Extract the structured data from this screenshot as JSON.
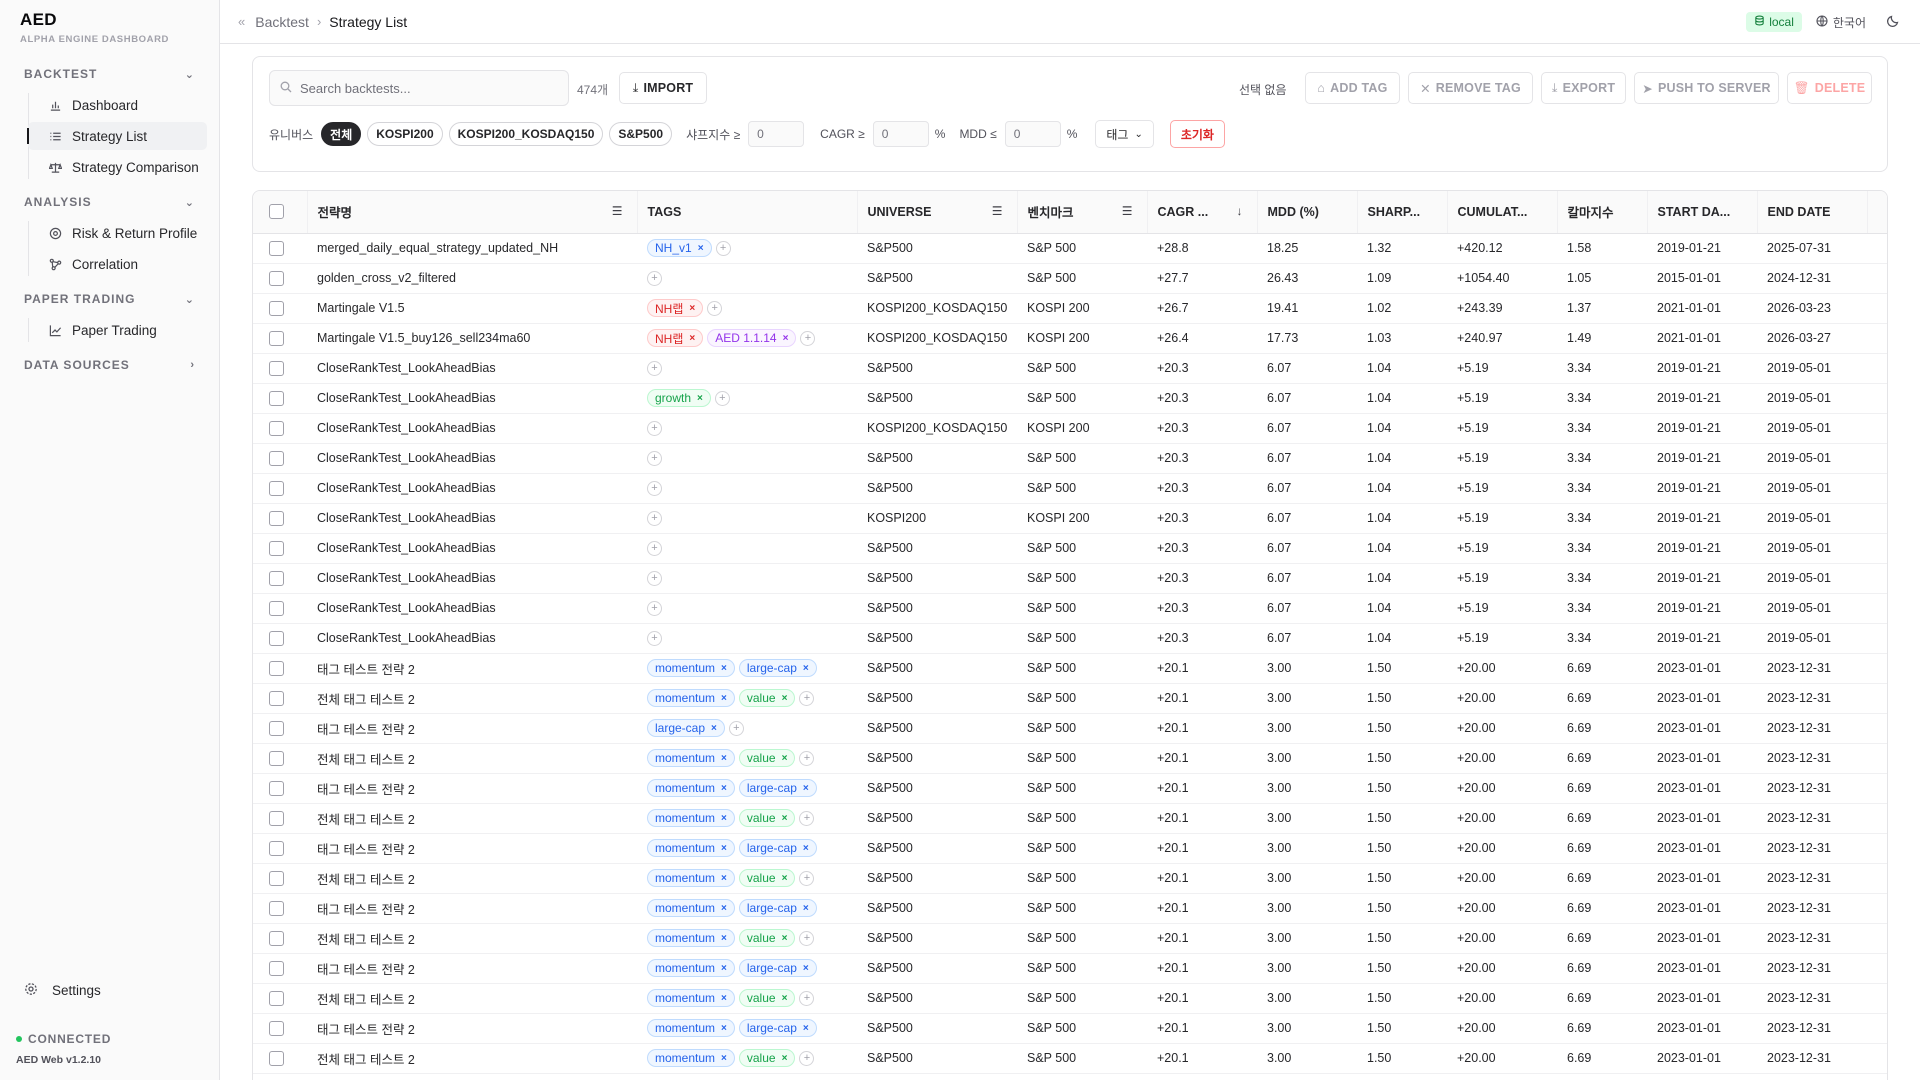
{
  "brand": {
    "name": "AED",
    "subtitle": "ALPHA ENGINE DASHBOARD"
  },
  "sidebar": {
    "sections": [
      {
        "label": "BACKTEST",
        "chevron": "chevron-down-icon",
        "items": [
          {
            "label": "Dashboard",
            "icon": "bar-chart-icon"
          },
          {
            "label": "Strategy List",
            "icon": "list-icon",
            "active": true
          },
          {
            "label": "Strategy Comparison",
            "icon": "scale-icon"
          }
        ]
      },
      {
        "label": "ANALYSIS",
        "chevron": "chevron-down-icon",
        "items": [
          {
            "label": "Risk & Return Profile",
            "icon": "target-icon"
          },
          {
            "label": "Correlation",
            "icon": "network-icon"
          }
        ]
      },
      {
        "label": "PAPER TRADING",
        "chevron": "chevron-down-icon",
        "items": [
          {
            "label": "Paper Trading",
            "icon": "line-chart-icon"
          }
        ]
      },
      {
        "label": "DATA SOURCES",
        "chevron": "chevron-right-icon",
        "items": []
      }
    ],
    "settings_label": "Settings",
    "status": "CONNECTED",
    "version": "AED Web v1.2.10"
  },
  "header": {
    "breadcrumb_parent": "Backtest",
    "breadcrumb_current": "Strategy List",
    "env_badge": "local",
    "language": "한국어"
  },
  "toolbar": {
    "search_placeholder": "Search backtests...",
    "count": "474개",
    "import_label": "IMPORT",
    "selection_text": "선택 없음",
    "add_tag_label": "ADD TAG",
    "remove_tag_label": "REMOVE TAG",
    "export_label": "EXPORT",
    "push_label": "PUSH TO SERVER",
    "delete_label": "DELETE"
  },
  "filters": {
    "universe_label": "유니버스",
    "universe_options": [
      "전체",
      "KOSPI200",
      "KOSPI200_KOSDAQ150",
      "S&P500"
    ],
    "sharpe_label": "샤프지수 ≥",
    "sharpe_value": "0",
    "cagr_label": "CAGR ≥",
    "cagr_value": "0",
    "mdd_label": "MDD ≤",
    "mdd_value": "0",
    "percent": "%",
    "tag_dropdown": "태그",
    "reset_label": "초기화"
  },
  "table": {
    "columns": [
      "전략명",
      "TAGS",
      "UNIVERSE",
      "벤치마크",
      "CAGR ...",
      "MDD (%)",
      "SHARP...",
      "CUMULAT...",
      "칼마지수",
      "START DA...",
      "END DATE"
    ],
    "rows": [
      {
        "name": "merged_daily_equal_strategy_updated_NH",
        "tags": [
          {
            "t": "NH_v1",
            "c": "blue"
          }
        ],
        "add": true,
        "universe": "S&P500",
        "bench": "S&P 500",
        "cagr": "+28.8",
        "mdd": "18.25",
        "sharpe": "1.32",
        "cum": "+420.12",
        "calmar": "1.58",
        "start": "2019-01-21",
        "end": "2025-07-31"
      },
      {
        "name": "golden_cross_v2_filtered",
        "tags": [],
        "add": true,
        "universe": "S&P500",
        "bench": "S&P 500",
        "cagr": "+27.7",
        "mdd": "26.43",
        "sharpe": "1.09",
        "cum": "+1054.40",
        "calmar": "1.05",
        "start": "2015-01-01",
        "end": "2024-12-31"
      },
      {
        "name": "Martingale V1.5",
        "tags": [
          {
            "t": "NH랩",
            "c": "red"
          }
        ],
        "add": true,
        "universe": "KOSPI200_KOSDAQ150",
        "bench": "KOSPI 200",
        "cagr": "+26.7",
        "mdd": "19.41",
        "sharpe": "1.02",
        "cum": "+243.39",
        "calmar": "1.37",
        "start": "2021-01-01",
        "end": "2026-03-23"
      },
      {
        "name": "Martingale V1.5_buy126_sell234ma60",
        "tags": [
          {
            "t": "NH랩",
            "c": "red"
          },
          {
            "t": "AED 1.1.14",
            "c": "purple"
          }
        ],
        "add": true,
        "universe": "KOSPI200_KOSDAQ150",
        "bench": "KOSPI 200",
        "cagr": "+26.4",
        "mdd": "17.73",
        "sharpe": "1.03",
        "cum": "+240.97",
        "calmar": "1.49",
        "start": "2021-01-01",
        "end": "2026-03-27"
      },
      {
        "name": "CloseRankTest_LookAheadBias",
        "tags": [],
        "add": true,
        "universe": "S&P500",
        "bench": "S&P 500",
        "cagr": "+20.3",
        "mdd": "6.07",
        "sharpe": "1.04",
        "cum": "+5.19",
        "calmar": "3.34",
        "start": "2019-01-21",
        "end": "2019-05-01"
      },
      {
        "name": "CloseRankTest_LookAheadBias",
        "tags": [
          {
            "t": "growth",
            "c": "green"
          }
        ],
        "add": true,
        "universe": "S&P500",
        "bench": "S&P 500",
        "cagr": "+20.3",
        "mdd": "6.07",
        "sharpe": "1.04",
        "cum": "+5.19",
        "calmar": "3.34",
        "start": "2019-01-21",
        "end": "2019-05-01"
      },
      {
        "name": "CloseRankTest_LookAheadBias",
        "tags": [],
        "add": true,
        "universe": "KOSPI200_KOSDAQ150",
        "bench": "KOSPI 200",
        "cagr": "+20.3",
        "mdd": "6.07",
        "sharpe": "1.04",
        "cum": "+5.19",
        "calmar": "3.34",
        "start": "2019-01-21",
        "end": "2019-05-01"
      },
      {
        "name": "CloseRankTest_LookAheadBias",
        "tags": [],
        "add": true,
        "universe": "S&P500",
        "bench": "S&P 500",
        "cagr": "+20.3",
        "mdd": "6.07",
        "sharpe": "1.04",
        "cum": "+5.19",
        "calmar": "3.34",
        "start": "2019-01-21",
        "end": "2019-05-01"
      },
      {
        "name": "CloseRankTest_LookAheadBias",
        "tags": [],
        "add": true,
        "universe": "S&P500",
        "bench": "S&P 500",
        "cagr": "+20.3",
        "mdd": "6.07",
        "sharpe": "1.04",
        "cum": "+5.19",
        "calmar": "3.34",
        "start": "2019-01-21",
        "end": "2019-05-01"
      },
      {
        "name": "CloseRankTest_LookAheadBias",
        "tags": [],
        "add": true,
        "universe": "KOSPI200",
        "bench": "KOSPI 200",
        "cagr": "+20.3",
        "mdd": "6.07",
        "sharpe": "1.04",
        "cum": "+5.19",
        "calmar": "3.34",
        "start": "2019-01-21",
        "end": "2019-05-01"
      },
      {
        "name": "CloseRankTest_LookAheadBias",
        "tags": [],
        "add": true,
        "universe": "S&P500",
        "bench": "S&P 500",
        "cagr": "+20.3",
        "mdd": "6.07",
        "sharpe": "1.04",
        "cum": "+5.19",
        "calmar": "3.34",
        "start": "2019-01-21",
        "end": "2019-05-01"
      },
      {
        "name": "CloseRankTest_LookAheadBias",
        "tags": [],
        "add": true,
        "universe": "S&P500",
        "bench": "S&P 500",
        "cagr": "+20.3",
        "mdd": "6.07",
        "sharpe": "1.04",
        "cum": "+5.19",
        "calmar": "3.34",
        "start": "2019-01-21",
        "end": "2019-05-01"
      },
      {
        "name": "CloseRankTest_LookAheadBias",
        "tags": [],
        "add": true,
        "universe": "S&P500",
        "bench": "S&P 500",
        "cagr": "+20.3",
        "mdd": "6.07",
        "sharpe": "1.04",
        "cum": "+5.19",
        "calmar": "3.34",
        "start": "2019-01-21",
        "end": "2019-05-01"
      },
      {
        "name": "CloseRankTest_LookAheadBias",
        "tags": [],
        "add": true,
        "universe": "S&P500",
        "bench": "S&P 500",
        "cagr": "+20.3",
        "mdd": "6.07",
        "sharpe": "1.04",
        "cum": "+5.19",
        "calmar": "3.34",
        "start": "2019-01-21",
        "end": "2019-05-01"
      },
      {
        "name": "태그 테스트 전략 2",
        "tags": [
          {
            "t": "momentum",
            "c": "blue"
          },
          {
            "t": "large-cap",
            "c": "blue"
          }
        ],
        "add": false,
        "universe": "S&P500",
        "bench": "S&P 500",
        "cagr": "+20.1",
        "mdd": "3.00",
        "sharpe": "1.50",
        "cum": "+20.00",
        "calmar": "6.69",
        "start": "2023-01-01",
        "end": "2023-12-31"
      },
      {
        "name": "전체 태그 테스트 2",
        "tags": [
          {
            "t": "momentum",
            "c": "blue"
          },
          {
            "t": "value",
            "c": "green"
          }
        ],
        "add": true,
        "universe": "S&P500",
        "bench": "S&P 500",
        "cagr": "+20.1",
        "mdd": "3.00",
        "sharpe": "1.50",
        "cum": "+20.00",
        "calmar": "6.69",
        "start": "2023-01-01",
        "end": "2023-12-31"
      },
      {
        "name": "태그 테스트 전략 2",
        "tags": [
          {
            "t": "large-cap",
            "c": "blue"
          }
        ],
        "add": true,
        "universe": "S&P500",
        "bench": "S&P 500",
        "cagr": "+20.1",
        "mdd": "3.00",
        "sharpe": "1.50",
        "cum": "+20.00",
        "calmar": "6.69",
        "start": "2023-01-01",
        "end": "2023-12-31"
      },
      {
        "name": "전체 태그 테스트 2",
        "tags": [
          {
            "t": "momentum",
            "c": "blue"
          },
          {
            "t": "value",
            "c": "green"
          }
        ],
        "add": true,
        "universe": "S&P500",
        "bench": "S&P 500",
        "cagr": "+20.1",
        "mdd": "3.00",
        "sharpe": "1.50",
        "cum": "+20.00",
        "calmar": "6.69",
        "start": "2023-01-01",
        "end": "2023-12-31"
      },
      {
        "name": "태그 테스트 전략 2",
        "tags": [
          {
            "t": "momentum",
            "c": "blue"
          },
          {
            "t": "large-cap",
            "c": "blue"
          }
        ],
        "add": false,
        "universe": "S&P500",
        "bench": "S&P 500",
        "cagr": "+20.1",
        "mdd": "3.00",
        "sharpe": "1.50",
        "cum": "+20.00",
        "calmar": "6.69",
        "start": "2023-01-01",
        "end": "2023-12-31"
      },
      {
        "name": "전체 태그 테스트 2",
        "tags": [
          {
            "t": "momentum",
            "c": "blue"
          },
          {
            "t": "value",
            "c": "green"
          }
        ],
        "add": true,
        "universe": "S&P500",
        "bench": "S&P 500",
        "cagr": "+20.1",
        "mdd": "3.00",
        "sharpe": "1.50",
        "cum": "+20.00",
        "calmar": "6.69",
        "start": "2023-01-01",
        "end": "2023-12-31"
      },
      {
        "name": "태그 테스트 전략 2",
        "tags": [
          {
            "t": "momentum",
            "c": "blue"
          },
          {
            "t": "large-cap",
            "c": "blue"
          }
        ],
        "add": false,
        "universe": "S&P500",
        "bench": "S&P 500",
        "cagr": "+20.1",
        "mdd": "3.00",
        "sharpe": "1.50",
        "cum": "+20.00",
        "calmar": "6.69",
        "start": "2023-01-01",
        "end": "2023-12-31"
      },
      {
        "name": "전체 태그 테스트 2",
        "tags": [
          {
            "t": "momentum",
            "c": "blue"
          },
          {
            "t": "value",
            "c": "green"
          }
        ],
        "add": true,
        "universe": "S&P500",
        "bench": "S&P 500",
        "cagr": "+20.1",
        "mdd": "3.00",
        "sharpe": "1.50",
        "cum": "+20.00",
        "calmar": "6.69",
        "start": "2023-01-01",
        "end": "2023-12-31"
      },
      {
        "name": "태그 테스트 전략 2",
        "tags": [
          {
            "t": "momentum",
            "c": "blue"
          },
          {
            "t": "large-cap",
            "c": "blue"
          }
        ],
        "add": false,
        "universe": "S&P500",
        "bench": "S&P 500",
        "cagr": "+20.1",
        "mdd": "3.00",
        "sharpe": "1.50",
        "cum": "+20.00",
        "calmar": "6.69",
        "start": "2023-01-01",
        "end": "2023-12-31"
      },
      {
        "name": "전체 태그 테스트 2",
        "tags": [
          {
            "t": "momentum",
            "c": "blue"
          },
          {
            "t": "value",
            "c": "green"
          }
        ],
        "add": true,
        "universe": "S&P500",
        "bench": "S&P 500",
        "cagr": "+20.1",
        "mdd": "3.00",
        "sharpe": "1.50",
        "cum": "+20.00",
        "calmar": "6.69",
        "start": "2023-01-01",
        "end": "2023-12-31"
      },
      {
        "name": "태그 테스트 전략 2",
        "tags": [
          {
            "t": "momentum",
            "c": "blue"
          },
          {
            "t": "large-cap",
            "c": "blue"
          }
        ],
        "add": false,
        "universe": "S&P500",
        "bench": "S&P 500",
        "cagr": "+20.1",
        "mdd": "3.00",
        "sharpe": "1.50",
        "cum": "+20.00",
        "calmar": "6.69",
        "start": "2023-01-01",
        "end": "2023-12-31"
      },
      {
        "name": "전체 태그 테스트 2",
        "tags": [
          {
            "t": "momentum",
            "c": "blue"
          },
          {
            "t": "value",
            "c": "green"
          }
        ],
        "add": true,
        "universe": "S&P500",
        "bench": "S&P 500",
        "cagr": "+20.1",
        "mdd": "3.00",
        "sharpe": "1.50",
        "cum": "+20.00",
        "calmar": "6.69",
        "start": "2023-01-01",
        "end": "2023-12-31"
      },
      {
        "name": "태그 테스트 전략 2",
        "tags": [
          {
            "t": "momentum",
            "c": "blue"
          },
          {
            "t": "large-cap",
            "c": "blue"
          }
        ],
        "add": false,
        "universe": "S&P500",
        "bench": "S&P 500",
        "cagr": "+20.1",
        "mdd": "3.00",
        "sharpe": "1.50",
        "cum": "+20.00",
        "calmar": "6.69",
        "start": "2023-01-01",
        "end": "2023-12-31"
      },
      {
        "name": "전체 태그 테스트 2",
        "tags": [
          {
            "t": "momentum",
            "c": "blue"
          },
          {
            "t": "value",
            "c": "green"
          }
        ],
        "add": true,
        "universe": "S&P500",
        "bench": "S&P 500",
        "cagr": "+20.1",
        "mdd": "3.00",
        "sharpe": "1.50",
        "cum": "+20.00",
        "calmar": "6.69",
        "start": "2023-01-01",
        "end": "2023-12-31"
      }
    ]
  }
}
